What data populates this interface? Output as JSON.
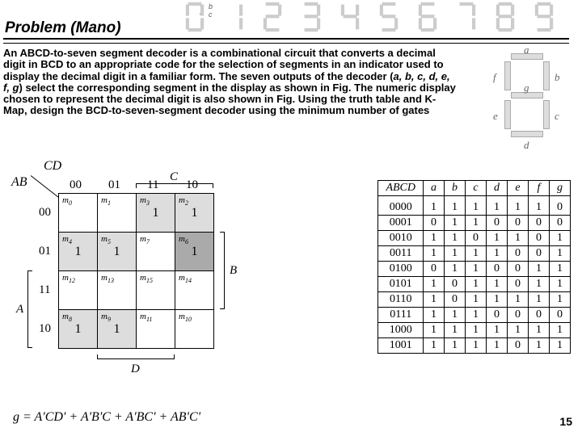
{
  "title": "Problem (Mano)",
  "digit_labels": {
    "b": "b",
    "c": "c"
  },
  "description": "An ABCD-to-seven segment decoder is a combinational circuit that converts a decimal digit in BCD to an appropriate code for the selection of segments in an indicator used to display the decimal digit in a familiar form. The seven outputs of the decoder (",
  "description_segs": "a, b, c, d, e, f, g",
  "description_tail": ") select the corresponding segment in the display as shown in Fig. The numeric display chosen to represent the decimal digit is also shown in Fig. Using the truth table and K-Map, design the BCD-to-seven-segment decoder using the minimum number of gates",
  "seven_seg_letters": {
    "a": "a",
    "b": "b",
    "c": "c",
    "d": "d",
    "e": "e",
    "f": "f",
    "g": "g"
  },
  "kmap": {
    "ab_label": "AB",
    "cd_label": "CD",
    "col_headers": [
      "00",
      "01",
      "11",
      "10"
    ],
    "row_headers": [
      "00",
      "01",
      "11",
      "10"
    ],
    "side_labels": {
      "A": "A",
      "B": "B",
      "C": "C",
      "D": "D"
    },
    "cells": [
      [
        {
          "m": "m",
          "i": "0",
          "v": ""
        },
        {
          "m": "m",
          "i": "1",
          "v": ""
        },
        {
          "m": "m",
          "i": "3",
          "v": "1"
        },
        {
          "m": "m",
          "i": "2",
          "v": "1"
        }
      ],
      [
        {
          "m": "m",
          "i": "4",
          "v": "1"
        },
        {
          "m": "m",
          "i": "5",
          "v": "1"
        },
        {
          "m": "m",
          "i": "7",
          "v": ""
        },
        {
          "m": "m",
          "i": "6",
          "v": "1"
        }
      ],
      [
        {
          "m": "m",
          "i": "12",
          "v": ""
        },
        {
          "m": "m",
          "i": "13",
          "v": ""
        },
        {
          "m": "m",
          "i": "15",
          "v": ""
        },
        {
          "m": "m",
          "i": "14",
          "v": ""
        }
      ],
      [
        {
          "m": "m",
          "i": "8",
          "v": "1"
        },
        {
          "m": "m",
          "i": "9",
          "v": "1"
        },
        {
          "m": "m",
          "i": "11",
          "v": ""
        },
        {
          "m": "m",
          "i": "10",
          "v": ""
        }
      ]
    ]
  },
  "truth_table": {
    "headers": [
      "ABCD",
      "a",
      "b",
      "c",
      "d",
      "e",
      "f",
      "g"
    ],
    "rows": [
      [
        "0000",
        "1",
        "1",
        "1",
        "1",
        "1",
        "1",
        "0"
      ],
      [
        "0001",
        "0",
        "1",
        "1",
        "0",
        "0",
        "0",
        "0"
      ],
      [
        "0010",
        "1",
        "1",
        "0",
        "1",
        "1",
        "0",
        "1"
      ],
      [
        "0011",
        "1",
        "1",
        "1",
        "1",
        "0",
        "0",
        "1"
      ],
      [
        "0100",
        "0",
        "1",
        "1",
        "0",
        "0",
        "1",
        "1"
      ],
      [
        "0101",
        "1",
        "0",
        "1",
        "1",
        "0",
        "1",
        "1"
      ],
      [
        "0110",
        "1",
        "0",
        "1",
        "1",
        "1",
        "1",
        "1"
      ],
      [
        "0111",
        "1",
        "1",
        "1",
        "0",
        "0",
        "0",
        "0"
      ],
      [
        "1000",
        "1",
        "1",
        "1",
        "1",
        "1",
        "1",
        "1"
      ],
      [
        "1001",
        "1",
        "1",
        "1",
        "1",
        "0",
        "1",
        "1"
      ]
    ]
  },
  "equation": "g = A'CD' + A'B'C + A'BC' + AB'C'",
  "page_number": "15",
  "chart_data": {
    "type": "table",
    "title": "BCD to seven-segment truth table and K-map for output g",
    "kmap_values": {
      "row_var": "AB",
      "col_var": "CD",
      "rows": [
        "00",
        "01",
        "11",
        "10"
      ],
      "cols": [
        "00",
        "01",
        "11",
        "10"
      ],
      "grid": [
        [
          0,
          0,
          1,
          1
        ],
        [
          1,
          1,
          0,
          1
        ],
        [
          0,
          0,
          0,
          0
        ],
        [
          1,
          1,
          0,
          0
        ]
      ]
    },
    "truth_table": {
      "inputs": [
        "A",
        "B",
        "C",
        "D"
      ],
      "outputs": [
        "a",
        "b",
        "c",
        "d",
        "e",
        "f",
        "g"
      ],
      "rows": [
        {
          "ABCD": "0000",
          "a": 1,
          "b": 1,
          "c": 1,
          "d": 1,
          "e": 1,
          "f": 1,
          "g": 0
        },
        {
          "ABCD": "0001",
          "a": 0,
          "b": 1,
          "c": 1,
          "d": 0,
          "e": 0,
          "f": 0,
          "g": 0
        },
        {
          "ABCD": "0010",
          "a": 1,
          "b": 1,
          "c": 0,
          "d": 1,
          "e": 1,
          "f": 0,
          "g": 1
        },
        {
          "ABCD": "0011",
          "a": 1,
          "b": 1,
          "c": 1,
          "d": 1,
          "e": 0,
          "f": 0,
          "g": 1
        },
        {
          "ABCD": "0100",
          "a": 0,
          "b": 1,
          "c": 1,
          "d": 0,
          "e": 0,
          "f": 1,
          "g": 1
        },
        {
          "ABCD": "0101",
          "a": 1,
          "b": 0,
          "c": 1,
          "d": 1,
          "e": 0,
          "f": 1,
          "g": 1
        },
        {
          "ABCD": "0110",
          "a": 1,
          "b": 0,
          "c": 1,
          "d": 1,
          "e": 1,
          "f": 1,
          "g": 1
        },
        {
          "ABCD": "0111",
          "a": 1,
          "b": 1,
          "c": 1,
          "d": 0,
          "e": 0,
          "f": 0,
          "g": 0
        },
        {
          "ABCD": "1000",
          "a": 1,
          "b": 1,
          "c": 1,
          "d": 1,
          "e": 1,
          "f": 1,
          "g": 1
        },
        {
          "ABCD": "1001",
          "a": 1,
          "b": 1,
          "c": 1,
          "d": 1,
          "e": 0,
          "f": 1,
          "g": 1
        }
      ]
    },
    "boolean_equation": "g = A'CD' + A'B'C + A'BC' + AB'C'"
  }
}
